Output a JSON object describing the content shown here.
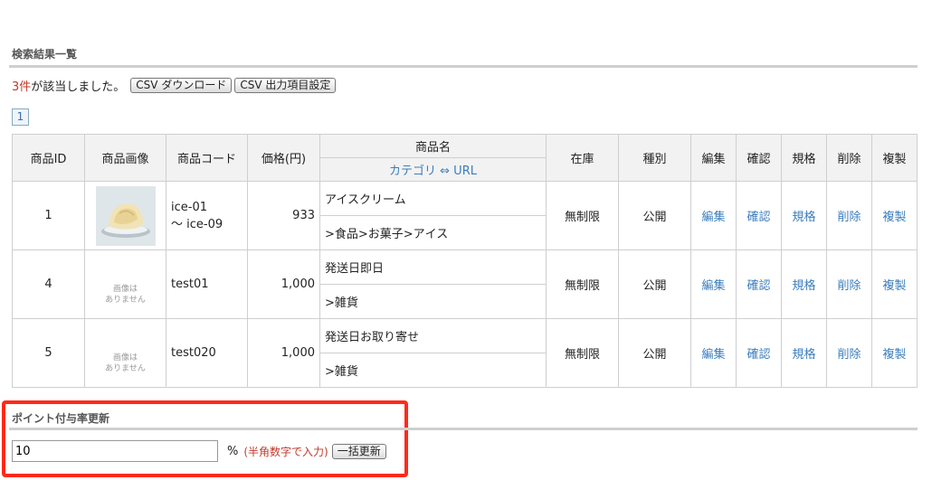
{
  "section": {
    "title": "検索結果一覧"
  },
  "result": {
    "count": "3件",
    "text": " が該当しました。",
    "csv_download": "CSV ダウンロード",
    "csv_settings": "CSV 出力項目設定"
  },
  "pager": {
    "current": "1"
  },
  "table": {
    "headers": {
      "id": "商品ID",
      "image": "商品画像",
      "code": "商品コード",
      "price": "価格(円)",
      "name": "商品名",
      "name_sub": "カテゴリ ⇔ URL",
      "stock": "在庫",
      "type": "種別",
      "edit": "編集",
      "confirm": "確認",
      "spec": "規格",
      "delete": "削除",
      "copy": "複製"
    },
    "rows": [
      {
        "id": "1",
        "code": "ice-01",
        "code2": "〜 ice-09",
        "price": "933",
        "name": "アイスクリーム",
        "category": ">食品>お菓子>アイス",
        "stock": "無制限",
        "type": "公開",
        "edit": "編集",
        "confirm": "確認",
        "spec": "規格",
        "delete": "削除",
        "copy": "複製"
      },
      {
        "id": "4",
        "noimg1": "画像は",
        "noimg2": "ありません",
        "code": "test01",
        "price": "1,000",
        "name": "発送日即日",
        "category": ">雑貨",
        "stock": "無制限",
        "type": "公開",
        "edit": "編集",
        "confirm": "確認",
        "spec": "規格",
        "delete": "削除",
        "copy": "複製"
      },
      {
        "id": "5",
        "noimg1": "画像は",
        "noimg2": "ありません",
        "code": "test020",
        "price": "1,000",
        "name": "発送日お取り寄せ",
        "category": ">雑貨",
        "stock": "無制限",
        "type": "公開",
        "edit": "編集",
        "confirm": "確認",
        "spec": "規格",
        "delete": "削除",
        "copy": "複製"
      }
    ]
  },
  "point": {
    "title": "ポイント付与率更新",
    "value": "10",
    "unit": "%",
    "note": "(半角数字で入力)",
    "update_button": "一括更新"
  },
  "colors": {
    "accent_red": "#c0392b",
    "link_blue": "#3b7dbd",
    "highlight": "#ff2a1a"
  }
}
